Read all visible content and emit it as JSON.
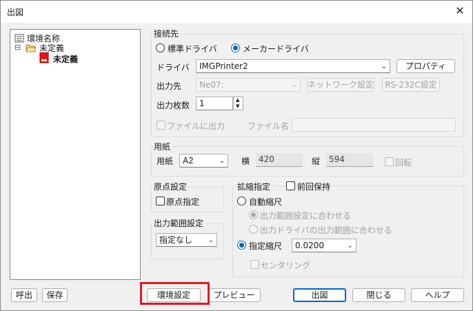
{
  "window": {
    "title": "出図"
  },
  "tree": {
    "root": "環境名称",
    "group": "未定義",
    "item": "未定義",
    "expander": "⊟"
  },
  "connection": {
    "group_label": "接続先",
    "radio_standard": "標準ドライバ",
    "radio_maker": "メーカードライバ",
    "driver_label": "ドライバ",
    "driver_value": "IMGPrinter2",
    "properties_button": "プロパティ",
    "output_label": "出力先",
    "output_value": "Ne07:",
    "network_button": "ネットワーク設定",
    "rs232c_button": "RS-232C設定",
    "copies_label": "出力枚数",
    "copies_value": "1",
    "file_output_label": "ファイルに出力",
    "filename_label": "ファイル名",
    "filename_value": ""
  },
  "paper": {
    "group_label": "用紙",
    "paper_label": "用紙",
    "paper_value": "A2",
    "width_label": "横",
    "width_value": "420",
    "height_label": "縦",
    "height_value": "594",
    "rotate_label": "回転"
  },
  "origin": {
    "group_label": "原点設定",
    "specify_label": "原点指定"
  },
  "range": {
    "group_label": "出力範囲設定",
    "value": "指定なし"
  },
  "scale": {
    "group_label": "拡縮指定",
    "keep_previous_label": "前回保持",
    "auto_label": "自動縮尺",
    "fit_range_label": "出力範囲設定に合わせる",
    "fit_driver_label": "出力ドライバの出力範囲に合わせる",
    "specified_label": "指定縮尺",
    "specified_value": "0.0200",
    "centering_label": "センタリング"
  },
  "footer": {
    "call_button": "呼出",
    "save_button": "保存",
    "env_button": "環境設定",
    "preview_button": "プレビュー",
    "output_button": "出図",
    "close_button": "閉じる",
    "help_button": "ヘルプ"
  },
  "colors": {
    "accent": "#0067c0",
    "highlight": "#e0181e"
  }
}
